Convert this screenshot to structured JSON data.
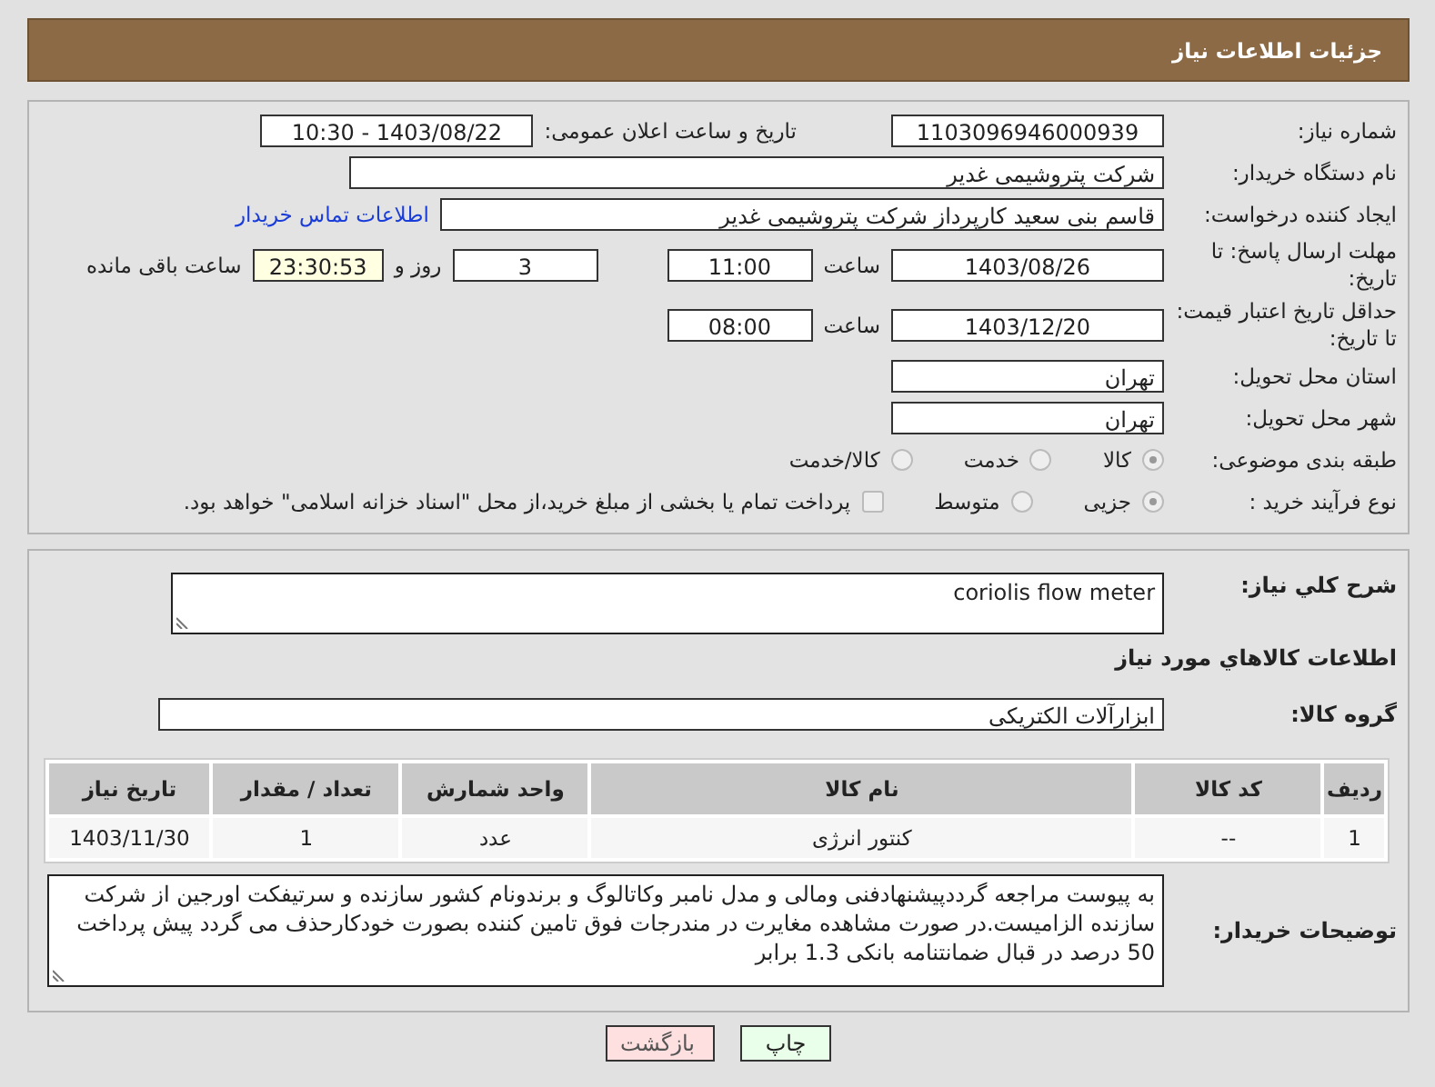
{
  "page_title": "جزئیات اطلاعات نیاز",
  "need_number": {
    "label": "شماره نیاز:",
    "value": "1103096946000939"
  },
  "announcement": {
    "label": "تاریخ و ساعت اعلان عمومی:",
    "value": "1403/08/22 - 10:30"
  },
  "buyer_org": {
    "label": "نام دستگاه خریدار:",
    "value": "شرکت پتروشیمی غدیر"
  },
  "requester": {
    "label": "ایجاد کننده درخواست:",
    "value": "قاسم بنی سعید کارپرداز شرکت پتروشیمی غدیر",
    "link": "اطلاعات تماس خریدار"
  },
  "reply_deadline": {
    "label": "مهلت ارسال پاسخ: تا تاریخ:",
    "date": "1403/08/26",
    "time_label": "ساعت",
    "time": "11:00",
    "days": "3",
    "days_label": "روز و",
    "remaining": "23:30:53",
    "remaining_label": "ساعت باقی مانده"
  },
  "price_validity": {
    "label": "حداقل تاریخ اعتبار قیمت: تا تاریخ:",
    "date": "1403/12/20",
    "time_label": "ساعت",
    "time": "08:00"
  },
  "province": {
    "label": "استان محل تحویل:",
    "value": "تهران"
  },
  "city": {
    "label": "شهر محل تحویل:",
    "value": "تهران"
  },
  "category": {
    "label": "طبقه بندی موضوعی:",
    "options": [
      {
        "label": "کالا",
        "selected": true
      },
      {
        "label": "خدمت",
        "selected": false
      },
      {
        "label": "کالا/خدمت",
        "selected": false
      }
    ]
  },
  "process": {
    "label": "نوع فرآیند خرید :",
    "options": [
      {
        "label": "جزیی",
        "selected": true
      },
      {
        "label": "متوسط",
        "selected": false
      }
    ],
    "treasury": {
      "label": "پرداخت تمام یا بخشی از مبلغ خرید،از محل \"اسناد خزانه اسلامی\" خواهد بود.",
      "checked": false
    }
  },
  "summary": {
    "label": "شرح کلي نياز:",
    "value": "coriolis flow meter"
  },
  "items_heading": "اطلاعات کالاهاي مورد نياز",
  "goods_group": {
    "label": "گروه کالا:",
    "value": "ابزارآلات الکتریکی"
  },
  "table": {
    "columns": [
      "ردیف",
      "کد کالا",
      "نام کالا",
      "واحد شمارش",
      "تعداد / مقدار",
      "تاریخ نیاز"
    ],
    "rows": [
      [
        "1",
        "--",
        "کنتور انرژی",
        "عدد",
        "1",
        "1403/11/30"
      ]
    ]
  },
  "buyer_notes": {
    "label": "توضیحات خریدار:",
    "value": "به پیوست مراجعه گرددپیشنهادفنی ومالی و مدل نامبر وکاتالوگ و برندونام کشور سازنده و سرتیفکت اورجین  از شرکت سازنده الزامیست.در صورت مشاهده مغایرت در مندرجات فوق تامین کننده بصورت خودکارحذف می گردد پیش پرداخت 50 درصد در قبال ضمانتنامه بانکی 1.3 برابر"
  },
  "buttons": [
    {
      "label": "چاپ",
      "kind": "print"
    },
    {
      "label": "بازگشت",
      "kind": "back"
    }
  ]
}
